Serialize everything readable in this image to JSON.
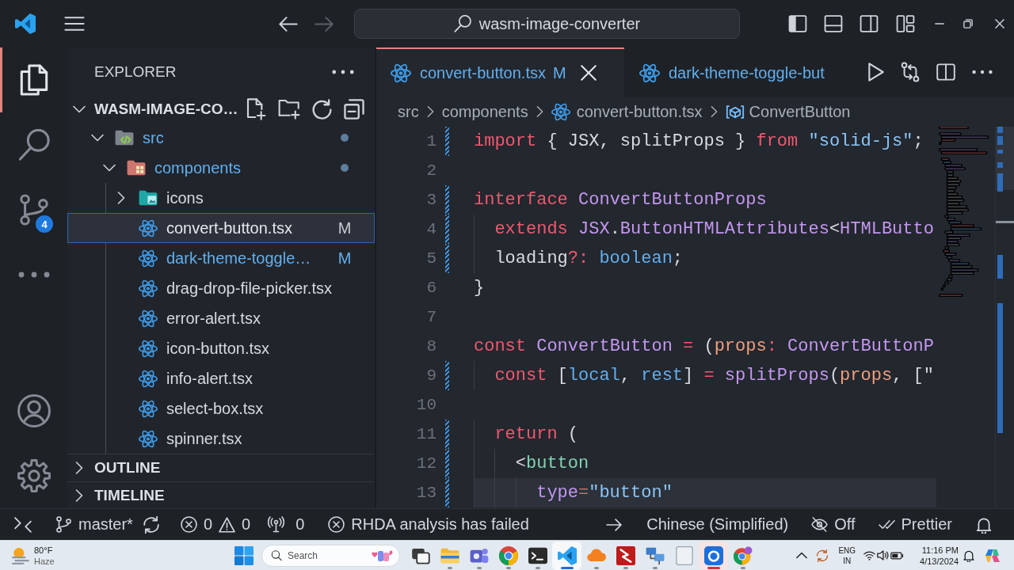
{
  "title_bar": {
    "nav": [
      {
        "kind": "back",
        "disabled": false
      },
      {
        "kind": "forward",
        "disabled": true
      }
    ],
    "command_center": {
      "text": "wasm-image-converter"
    },
    "layout_toggles": [
      {
        "kind": "primary-sidebar",
        "on": true
      },
      {
        "kind": "panel",
        "on": false
      },
      {
        "kind": "secondary-sidebar",
        "on": false
      }
    ]
  },
  "activity_bar": {
    "items": [
      {
        "kind": "explorer",
        "selected": true
      },
      {
        "kind": "search",
        "selected": false
      },
      {
        "kind": "source-control",
        "selected": false,
        "badge": "4"
      },
      {
        "kind": "more",
        "selected": false
      }
    ],
    "bottom": [
      {
        "kind": "accounts"
      },
      {
        "kind": "manage"
      }
    ]
  },
  "sidebar": {
    "title": "EXPLORER",
    "sections": [
      {
        "title": "WASM-IMAGE-CO…",
        "expanded": true,
        "tree": [
          {
            "label": "src",
            "kind": "code-folder",
            "expanded": true,
            "modified": true,
            "selected": false,
            "children": [
              {
                "label": "components",
                "kind": "component-folder",
                "expanded": true,
                "modified": true,
                "selected": false,
                "children": [
                  {
                    "label": "icons",
                    "kind": "image-folder",
                    "expanded": false,
                    "modified": false,
                    "selected": false
                  },
                  {
                    "label": "convert-button.tsx",
                    "kind": "react-file",
                    "modified": true,
                    "status": "M",
                    "selected": true
                  },
                  {
                    "label": "dark-theme-toggle…",
                    "kind": "react-file",
                    "modified": true,
                    "status": "M",
                    "selected": false
                  },
                  {
                    "label": "drag-drop-file-picker.tsx",
                    "kind": "react-file",
                    "modified": false,
                    "selected": false
                  },
                  {
                    "label": "error-alert.tsx",
                    "kind": "react-file",
                    "modified": false,
                    "selected": false
                  },
                  {
                    "label": "icon-button.tsx",
                    "kind": "react-file",
                    "modified": false,
                    "selected": false
                  },
                  {
                    "label": "info-alert.tsx",
                    "kind": "react-file",
                    "modified": false,
                    "selected": false
                  },
                  {
                    "label": "select-box.tsx",
                    "kind": "react-file",
                    "modified": false,
                    "selected": false
                  },
                  {
                    "label": "spinner.tsx",
                    "kind": "react-file",
                    "modified": false,
                    "selected": false
                  }
                ]
              }
            ]
          }
        ]
      },
      {
        "title": "OUTLINE",
        "expanded": false
      },
      {
        "title": "TIMELINE",
        "expanded": false
      }
    ]
  },
  "editor": {
    "tabs": [
      {
        "label": "convert-button.tsx",
        "kind": "react-file",
        "modified": true,
        "status": "M",
        "selected": true
      },
      {
        "label": "dark-theme-toggle-but",
        "kind": "react-file",
        "modified": true,
        "selected": false
      }
    ],
    "breadcrumbs": [
      {
        "label": "src",
        "kind": "folder"
      },
      {
        "label": "components",
        "kind": "folder"
      },
      {
        "label": "convert-button.tsx",
        "kind": "react-file"
      },
      {
        "label": "ConvertButton",
        "kind": "symbol"
      }
    ],
    "lines": [
      {
        "number": "1",
        "changed": true,
        "highlighted": false,
        "tokens": [
          {
            "text": "import",
            "kind": "keyword"
          },
          {
            "text": " { JSX, splitProps } ",
            "kind": "plain"
          },
          {
            "text": "from ",
            "kind": "keyword"
          },
          {
            "text": "\"solid-js\"",
            "kind": "string"
          },
          {
            "text": ";",
            "kind": "plain"
          }
        ]
      },
      {
        "number": "2",
        "changed": false,
        "highlighted": false
      },
      {
        "number": "3",
        "changed": true,
        "highlighted": false,
        "tokens": [
          {
            "text": "interface ",
            "kind": "keyword"
          },
          {
            "text": "ConvertButtonProps",
            "kind": "type"
          }
        ]
      },
      {
        "number": "4",
        "changed": true,
        "highlighted": false,
        "tokens": [
          {
            "text": "  extends ",
            "kind": "keyword"
          },
          {
            "text": "JSX",
            "kind": "type"
          },
          {
            "text": ".",
            "kind": "plain"
          },
          {
            "text": "ButtonHTMLAttributes",
            "kind": "type"
          },
          {
            "text": "<",
            "kind": "plain"
          },
          {
            "text": "HTMLButto",
            "kind": "type"
          }
        ]
      },
      {
        "number": "5",
        "changed": true,
        "highlighted": false,
        "tokens": [
          {
            "text": "  loading",
            "kind": "plain"
          },
          {
            "text": "?: ",
            "kind": "keyword"
          },
          {
            "text": "boolean",
            "kind": "builtin"
          },
          {
            "text": ";",
            "kind": "plain"
          }
        ]
      },
      {
        "number": "6",
        "changed": false,
        "highlighted": false,
        "tokens": [
          {
            "text": "}",
            "kind": "plain"
          }
        ]
      },
      {
        "number": "7",
        "changed": false,
        "highlighted": false
      },
      {
        "number": "8",
        "changed": false,
        "highlighted": false,
        "tokens": [
          {
            "text": "const ",
            "kind": "keyword"
          },
          {
            "text": "ConvertButton ",
            "kind": "type"
          },
          {
            "text": "=",
            "kind": "keyword"
          },
          {
            "text": " (",
            "kind": "plain"
          },
          {
            "text": "props",
            "kind": "param"
          },
          {
            "text": ": ",
            "kind": "keyword"
          },
          {
            "text": "ConvertButtonP",
            "kind": "type"
          }
        ]
      },
      {
        "number": "9",
        "changed": true,
        "highlighted": false,
        "tokens": [
          {
            "text": "  const",
            "kind": "keyword"
          },
          {
            "text": " [",
            "kind": "plain"
          },
          {
            "text": "local",
            "kind": "variable"
          },
          {
            "text": ", ",
            "kind": "plain"
          },
          {
            "text": "rest",
            "kind": "variable"
          },
          {
            "text": "] ",
            "kind": "plain"
          },
          {
            "text": "= ",
            "kind": "keyword"
          },
          {
            "text": "splitProps",
            "kind": "type"
          },
          {
            "text": "(",
            "kind": "plain"
          },
          {
            "text": "props",
            "kind": "param"
          },
          {
            "text": ", [\"",
            "kind": "plain"
          }
        ]
      },
      {
        "number": "10",
        "changed": false,
        "highlighted": false
      },
      {
        "number": "11",
        "changed": true,
        "highlighted": false,
        "tokens": [
          {
            "text": "  return",
            "kind": "keyword"
          },
          {
            "text": " (",
            "kind": "plain"
          }
        ]
      },
      {
        "number": "12",
        "changed": true,
        "highlighted": false,
        "tokens": [
          {
            "text": "    <",
            "kind": "plain"
          },
          {
            "text": "button",
            "kind": "tag"
          }
        ]
      },
      {
        "number": "13",
        "changed": true,
        "highlighted": true,
        "tokens": [
          {
            "text": "      type",
            "kind": "attr"
          },
          {
            "text": "=",
            "kind": "keyword"
          },
          {
            "text": "\"button\"",
            "kind": "string"
          }
        ]
      }
    ]
  },
  "status_bar": {
    "left": [
      {
        "kind": "remote"
      },
      {
        "kind": "branch",
        "label": "master*"
      },
      {
        "kind": "sync"
      },
      {
        "kind": "problems",
        "errors": "0",
        "warnings": "0"
      },
      {
        "kind": "ports",
        "label": "0"
      },
      {
        "kind": "analysis",
        "label": "RHDA analysis has failed"
      }
    ],
    "right": [
      {
        "kind": "go-to"
      },
      {
        "kind": "language",
        "label": "Chinese (Simplified)"
      },
      {
        "kind": "visibility",
        "label": "Off"
      },
      {
        "kind": "formatter",
        "label": "Prettier"
      },
      {
        "kind": "notifications"
      }
    ]
  },
  "taskbar": {
    "weather": {
      "temperature": "80°F",
      "condition": "Haze"
    },
    "search": {
      "placeholder": "Search"
    },
    "apps": [
      {
        "kind": "task-view",
        "running": false,
        "focused": false,
        "attention": false
      },
      {
        "kind": "files",
        "running": true,
        "focused": false,
        "attention": false
      },
      {
        "kind": "chat",
        "running": true,
        "focused": false,
        "attention": false
      },
      {
        "kind": "browser",
        "running": true,
        "focused": false,
        "attention": false
      },
      {
        "kind": "terminal",
        "running": true,
        "focused": false,
        "attention": false
      },
      {
        "kind": "code-editor",
        "running": true,
        "focused": true,
        "attention": false
      },
      {
        "kind": "cloud",
        "running": true,
        "focused": false,
        "attention": false
      },
      {
        "kind": "ftp",
        "running": true,
        "focused": false,
        "attention": false
      },
      {
        "kind": "network",
        "running": true,
        "focused": false,
        "attention": false
      },
      {
        "kind": "blank",
        "running": false,
        "focused": false,
        "attention": false
      },
      {
        "kind": "media",
        "running": true,
        "focused": false,
        "attention": true
      },
      {
        "kind": "browser-profile",
        "running": true,
        "focused": false,
        "attention": false
      }
    ],
    "tray": {
      "language": "ENG",
      "region": "IN",
      "time": "11:16 PM",
      "date": "4/13/2024"
    }
  }
}
